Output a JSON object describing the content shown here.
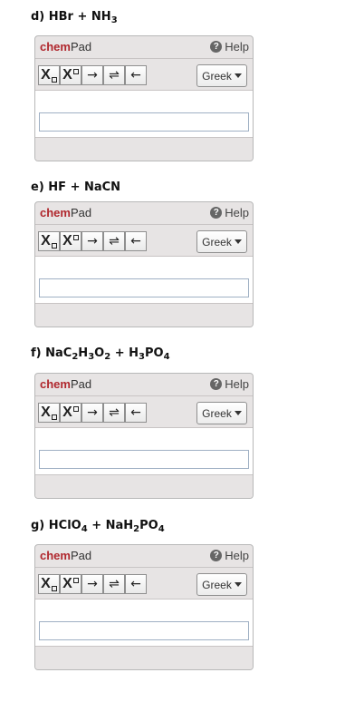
{
  "questions": [
    {
      "id": "d",
      "label_parts": [
        "d) HBr + NH",
        "3",
        ""
      ],
      "pad": {
        "brand_strong": "chem",
        "brand_rest": "Pad",
        "help_label": "Help",
        "greek_label": "Greek",
        "input_value": ""
      }
    },
    {
      "id": "e",
      "label_parts": [
        "e) HF + NaCN"
      ],
      "pad": {
        "brand_strong": "chem",
        "brand_rest": "Pad",
        "help_label": "Help",
        "greek_label": "Greek",
        "input_value": ""
      }
    },
    {
      "id": "f",
      "label_parts": [
        "f) NaC",
        "2",
        "H",
        "3",
        "O",
        "2",
        " + H",
        "3",
        "PO",
        "4"
      ],
      "pad": {
        "brand_strong": "chem",
        "brand_rest": "Pad",
        "help_label": "Help",
        "greek_label": "Greek",
        "input_value": ""
      }
    },
    {
      "id": "g",
      "label_parts": [
        "g) HClO",
        "4",
        " + NaH",
        "2",
        "PO",
        "4"
      ],
      "pad": {
        "brand_strong": "chem",
        "brand_rest": "Pad",
        "help_label": "Help",
        "greek_label": "Greek",
        "input_value": ""
      }
    }
  ],
  "toolbar_buttons": [
    {
      "name": "subscript-button",
      "glyph": "X",
      "kind": "sub"
    },
    {
      "name": "superscript-button",
      "glyph": "X",
      "kind": "sup"
    },
    {
      "name": "right-arrow-button",
      "glyph": "→",
      "kind": "plain"
    },
    {
      "name": "equilibrium-arrow-button",
      "glyph": "⇌",
      "kind": "plain"
    },
    {
      "name": "left-arrow-button",
      "glyph": "←",
      "kind": "plain"
    }
  ],
  "colors": {
    "brand_red": "#b0272d",
    "panel_bg": "#e7e4e4",
    "input_border": "#9fb0c4"
  },
  "icons": {
    "help": "question-circle-icon",
    "greek_dropdown": "caret-down-icon"
  }
}
